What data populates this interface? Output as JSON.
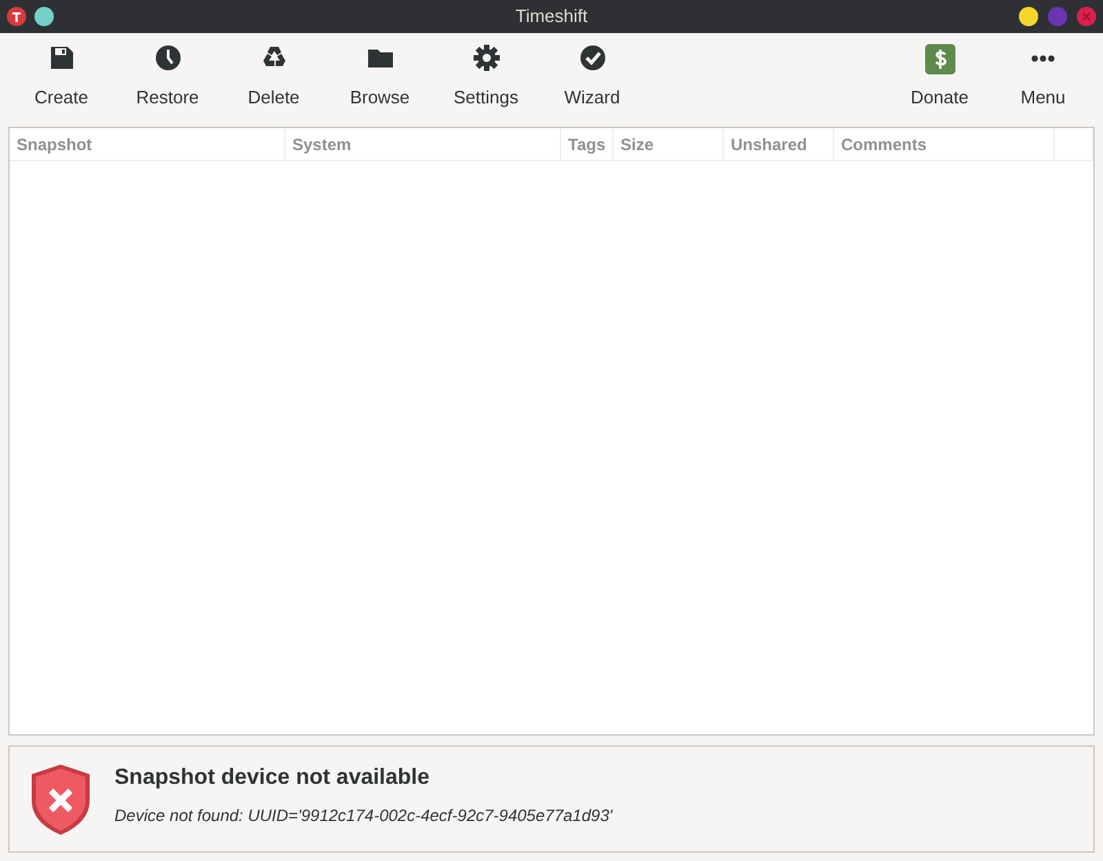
{
  "window": {
    "title": "Timeshift"
  },
  "toolbar": [
    {
      "label": "Create",
      "kind": "save"
    },
    {
      "label": "Restore",
      "kind": "clock"
    },
    {
      "label": "Delete",
      "kind": "recycle"
    },
    {
      "label": "Browse",
      "kind": "folder"
    },
    {
      "label": "Settings",
      "kind": "gear"
    },
    {
      "label": "Wizard",
      "kind": "check"
    }
  ],
  "toolbar_right": [
    {
      "label": "Donate",
      "kind": "dollar"
    },
    {
      "label": "Menu",
      "kind": "dots"
    }
  ],
  "table": {
    "columns": [
      "Snapshot",
      "System",
      "Tags",
      "Size",
      "Unshared",
      "Comments"
    ]
  },
  "status": {
    "title": "Snapshot device not available",
    "message": "Device not found: UUID='9912c174-002c-4ecf-92c7-9405e77a1d93'"
  }
}
